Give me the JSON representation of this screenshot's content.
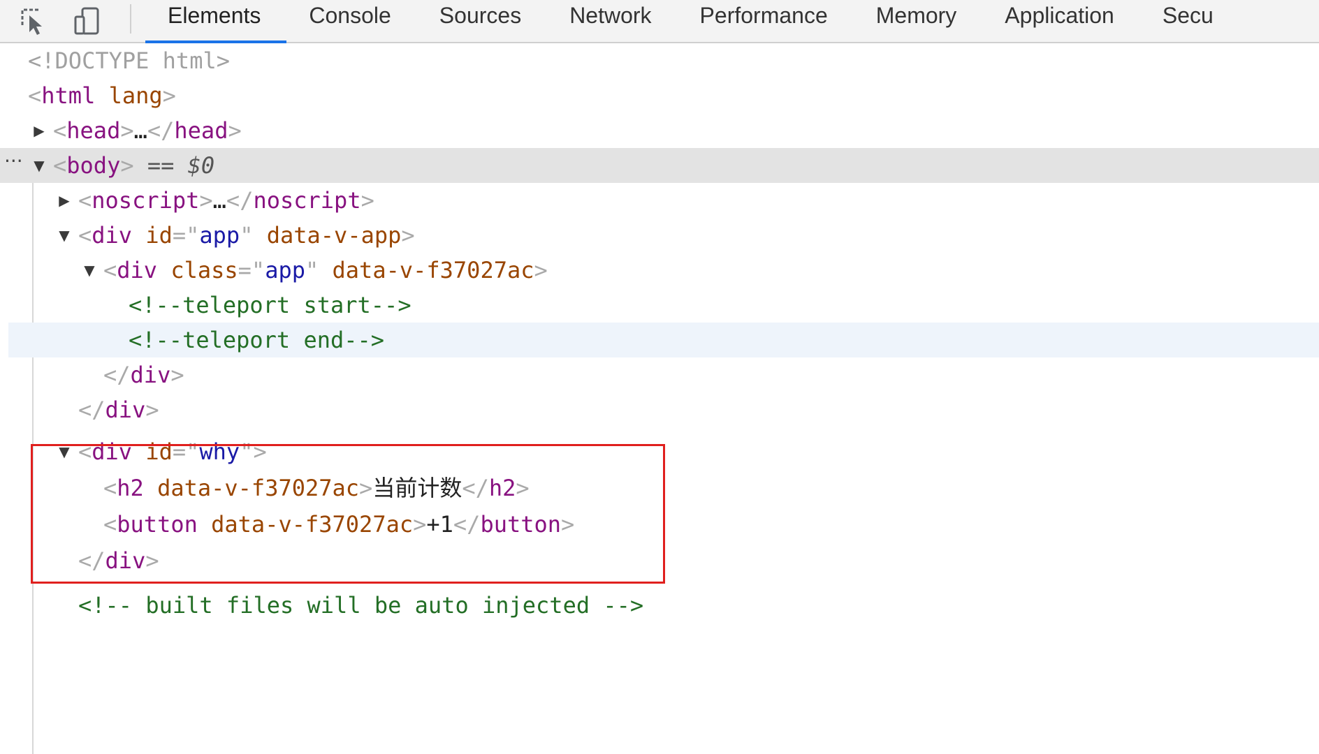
{
  "toolbar": {
    "tabs": [
      "Elements",
      "Console",
      "Sources",
      "Network",
      "Performance",
      "Memory",
      "Application",
      "Secu"
    ],
    "active_tab": "Elements",
    "accent_color": "#1a73e8"
  },
  "tree": {
    "doctype": "<!DOCTYPE html>",
    "html_tag": "html",
    "html_attr": "lang",
    "head_tag": "head",
    "ellipsis": "…",
    "body_tag": "body",
    "selected_marker": "== $0",
    "noscript_tag": "noscript",
    "div_tag": "div",
    "id_attr": "id",
    "class_attr": "class",
    "app_id_value": "app",
    "data_v_app": "data-v-app",
    "app_class_value": "app",
    "data_v_scope": "data-v-f37027ac",
    "teleport_start": "<!--teleport start-->",
    "teleport_end": "<!--teleport end-->",
    "why_id_value": "why",
    "h2_tag": "h2",
    "h2_text": "当前计数",
    "button_tag": "button",
    "button_text": "+1",
    "built_comment": "<!-- built files will be auto injected -->"
  },
  "colors": {
    "tag": "#881280",
    "attribute": "#994500",
    "value": "#1a1aa6",
    "comment": "#236e25",
    "selection_background": "#e3e3e3",
    "highlight_box": "#e0201e"
  }
}
